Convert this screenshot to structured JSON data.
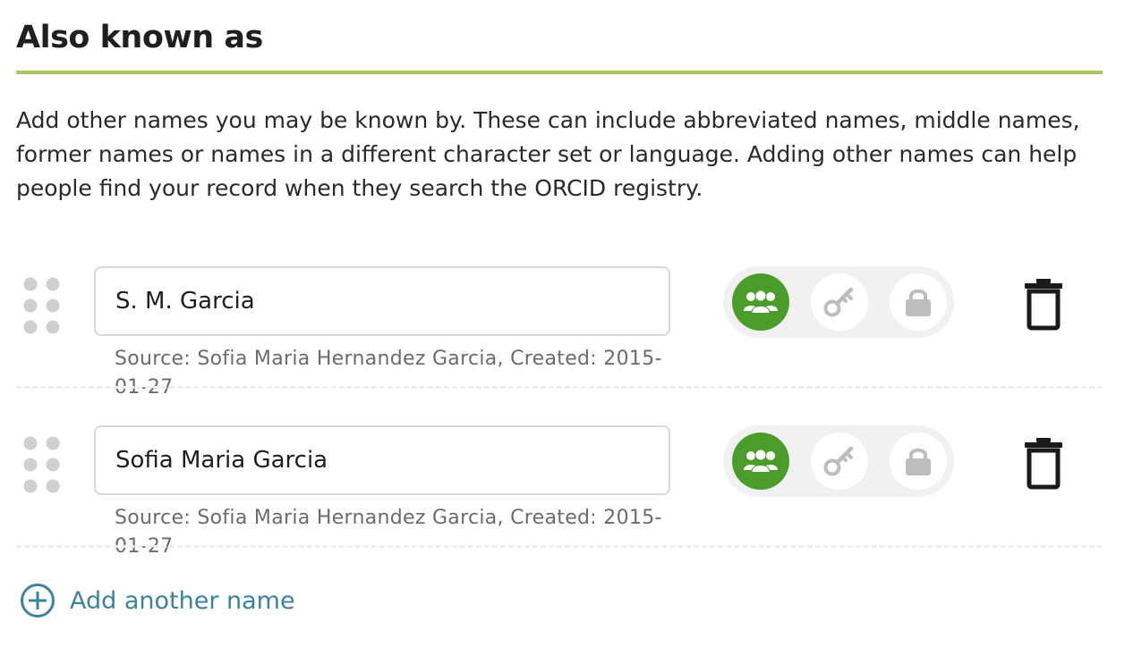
{
  "section": {
    "title": "Also known as",
    "description": "Add other names you may be known by. These can include abbreviated names, middle names, former names or names in a different character set or language. Adding other names can help people find your record when they search the ORCID registry."
  },
  "names": [
    {
      "value": "S. M. Garcia",
      "source": "Source: Sofia Maria Hernandez Garcia, Created: 2015-01-27",
      "visibility": "everyone"
    },
    {
      "value": "Sofia Maria Garcia",
      "source": "Source: Sofia Maria Hernandez Garcia, Created: 2015-01-27",
      "visibility": "everyone"
    }
  ],
  "privacy_options": [
    "everyone",
    "trusted-parties",
    "only-me"
  ],
  "add_link": {
    "label": "Add another name"
  },
  "colors": {
    "accent_rule": "#a8c95a",
    "visibility_active": "#4b9d2b",
    "visibility_inactive_icon": "#bdbdbd",
    "link": "#3b82a0",
    "delete_icon": "#1a1a1a"
  },
  "icons": {
    "drag": "drag-handle-icon",
    "everyone": "people-icon",
    "trusted": "key-icon",
    "only_me": "lock-icon",
    "delete": "trash-icon",
    "add": "plus-circle-icon"
  }
}
